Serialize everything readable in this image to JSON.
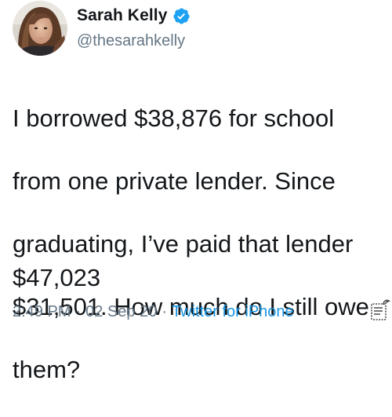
{
  "user": {
    "display_name": "Sarah Kelly",
    "handle": "@thesarahkelly",
    "verified": true,
    "avatar_icon": "profile-photo",
    "verified_icon": "verified-badge-icon"
  },
  "tweet": {
    "lines": [
      "I borrowed $38,876 for school",
      "from one private lender. Since",
      "graduating, I’ve paid that lender",
      "$31,501. How much do I still owe",
      "them?"
    ],
    "answer": "$47,023"
  },
  "meta": {
    "time": "2:49 PM",
    "separator": "·",
    "date": "02 Sep 20",
    "source": "Twitter for iPhone"
  },
  "colors": {
    "text": "#14171a",
    "secondary": "#657786",
    "link": "#1b95e0",
    "verified": "#1da1f2"
  },
  "icons": {
    "analytics": "analytics-icon"
  }
}
